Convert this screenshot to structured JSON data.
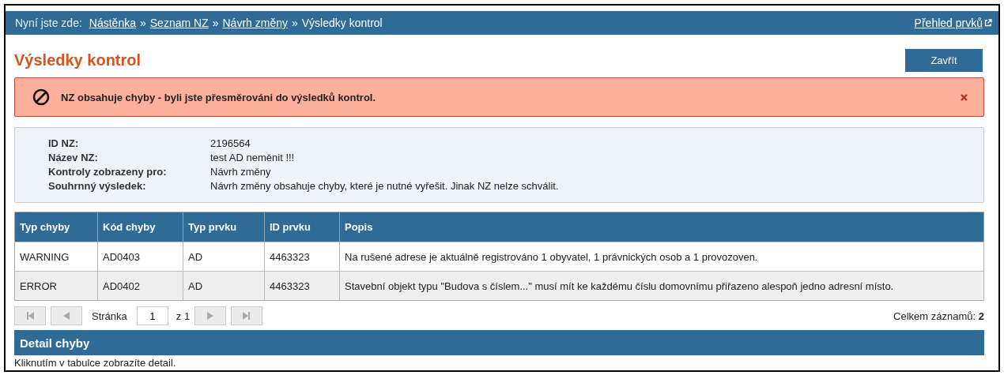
{
  "breadcrumb": {
    "label": "Nyní jste zde:",
    "items": [
      {
        "text": "Nástěnka",
        "kind": "link"
      },
      {
        "text": "Seznam NZ",
        "kind": "link"
      },
      {
        "text": "Návrh změny",
        "kind": "link"
      },
      {
        "text": "Výsledky kontrol",
        "kind": "current"
      }
    ],
    "separator": "»",
    "right_link": "Přehled prvků"
  },
  "page_title": "Výsledky kontrol",
  "close_button": "Zavřít",
  "alert": {
    "message": "NZ obsahuje chyby - byli jste přesměrováni do výsledků kontrol."
  },
  "info": [
    {
      "label": "ID NZ:",
      "value": "2196564"
    },
    {
      "label": "Název NZ:",
      "value": "test AD neměnit !!!"
    },
    {
      "label": "Kontroly zobrazeny pro:",
      "value": "Návrh změny"
    },
    {
      "label": "Souhrnný výsledek:",
      "value": "Návrh změny obsahuje chyby, které je nutné vyřešit. Jinak NZ nelze schválit."
    }
  ],
  "table": {
    "columns": [
      "Typ chyby",
      "Kód chyby",
      "Typ prvku",
      "ID prvku",
      "Popis"
    ],
    "rows": [
      [
        "WARNING",
        "AD0403",
        "AD",
        "4463323",
        "Na rušené adrese je aktuálně registrováno 1 obyvatel, 1 právnických osob a 1 provozoven."
      ],
      [
        "ERROR",
        "AD0402",
        "AD",
        "4463323",
        "Stavební objekt typu \"Budova s číslem...\" musí mít ke každému číslu domovnímu přiřazeno alespoň jedno adresní místo."
      ]
    ]
  },
  "pager": {
    "first": {
      "disabled": true
    },
    "prev": {
      "disabled": true
    },
    "page_label": "Stránka",
    "page": "1",
    "of": "z 1",
    "next": {
      "disabled": true
    },
    "last": {
      "disabled": true
    },
    "total": "Celkem záznamů: **2**"
  },
  "detail": {
    "title": "Detail chyby",
    "hint": "Kliknutím v tabulce zobrazíte detail."
  }
}
